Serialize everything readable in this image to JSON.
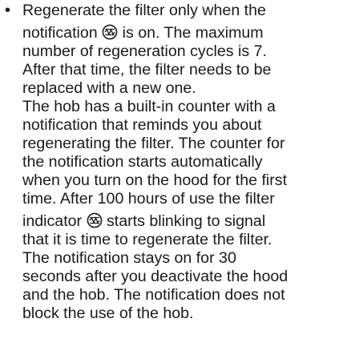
{
  "document": {
    "bullet": "•",
    "lines_before_icon_1": "Regenerate the filter only when the",
    "icon_1": "filter-icon",
    "line_2_prefix": "notification",
    "line_2_suffix": "is on. The maximum",
    "lines": [
      "number of regeneration cycles is 7.",
      "After that time, the filter needs to be",
      "replaced with a new one.",
      "The hob has a built-in counter with a",
      "notification that reminds you about",
      "regenerating the filter. The counter for",
      "the notification starts automatically",
      "when you turn on the hood for the first",
      "time. After 100 hours of use the filter"
    ],
    "icon_2": "filter-icon",
    "line_icon2_prefix": "indicator",
    "line_icon2_suffix": "starts blinking to signal",
    "lines_after": [
      "that it is time to regenerate the filter.",
      "The notification stays on for 30",
      "seconds after you deactivate the hood",
      "and the hob. The notification does not",
      "block the use of the hob."
    ]
  }
}
